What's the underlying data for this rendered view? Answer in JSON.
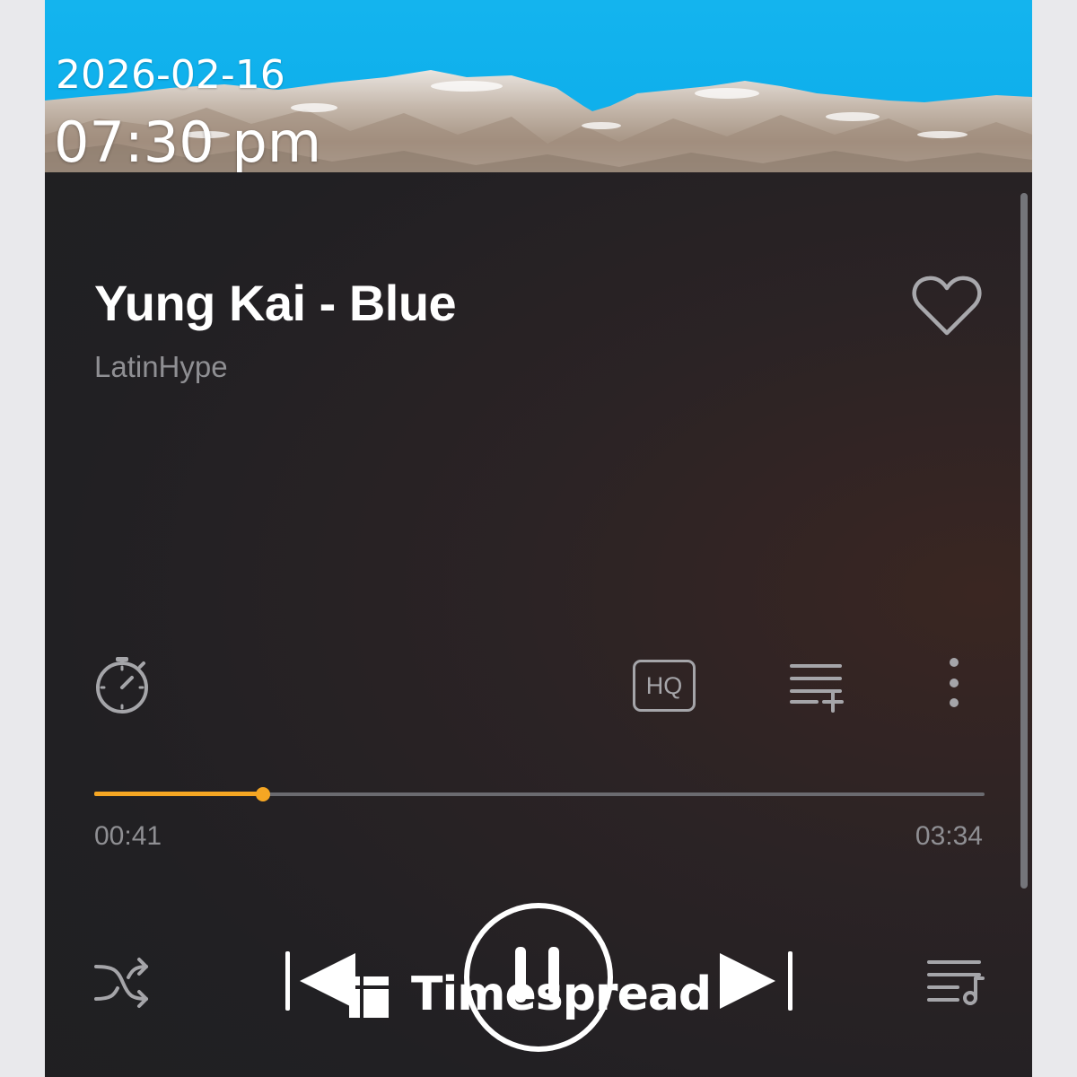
{
  "status": {
    "date": "2026-02-16",
    "time": "07:30 pm"
  },
  "track": {
    "title": "Yung Kai - Blue",
    "artist": "LatinHype",
    "liked": false
  },
  "controls": {
    "quality_label": "HQ",
    "elapsed": "00:41",
    "duration": "03:34",
    "progress_fraction": 0.19,
    "playing": true
  },
  "watermark": {
    "text": "Timespread"
  },
  "icons": {
    "like": "heart-outline-icon",
    "timer": "stopwatch-icon",
    "add_to_playlist": "playlist-add-icon",
    "more": "more-vertical-icon",
    "shuffle": "shuffle-icon",
    "previous": "skip-previous-icon",
    "pause": "pause-icon",
    "next": "skip-next-icon",
    "queue": "queue-music-icon"
  },
  "colors": {
    "accent": "#f5a623",
    "sky": "#12b2ee",
    "background": "#212023",
    "floating_button": "#1c7fd6"
  }
}
